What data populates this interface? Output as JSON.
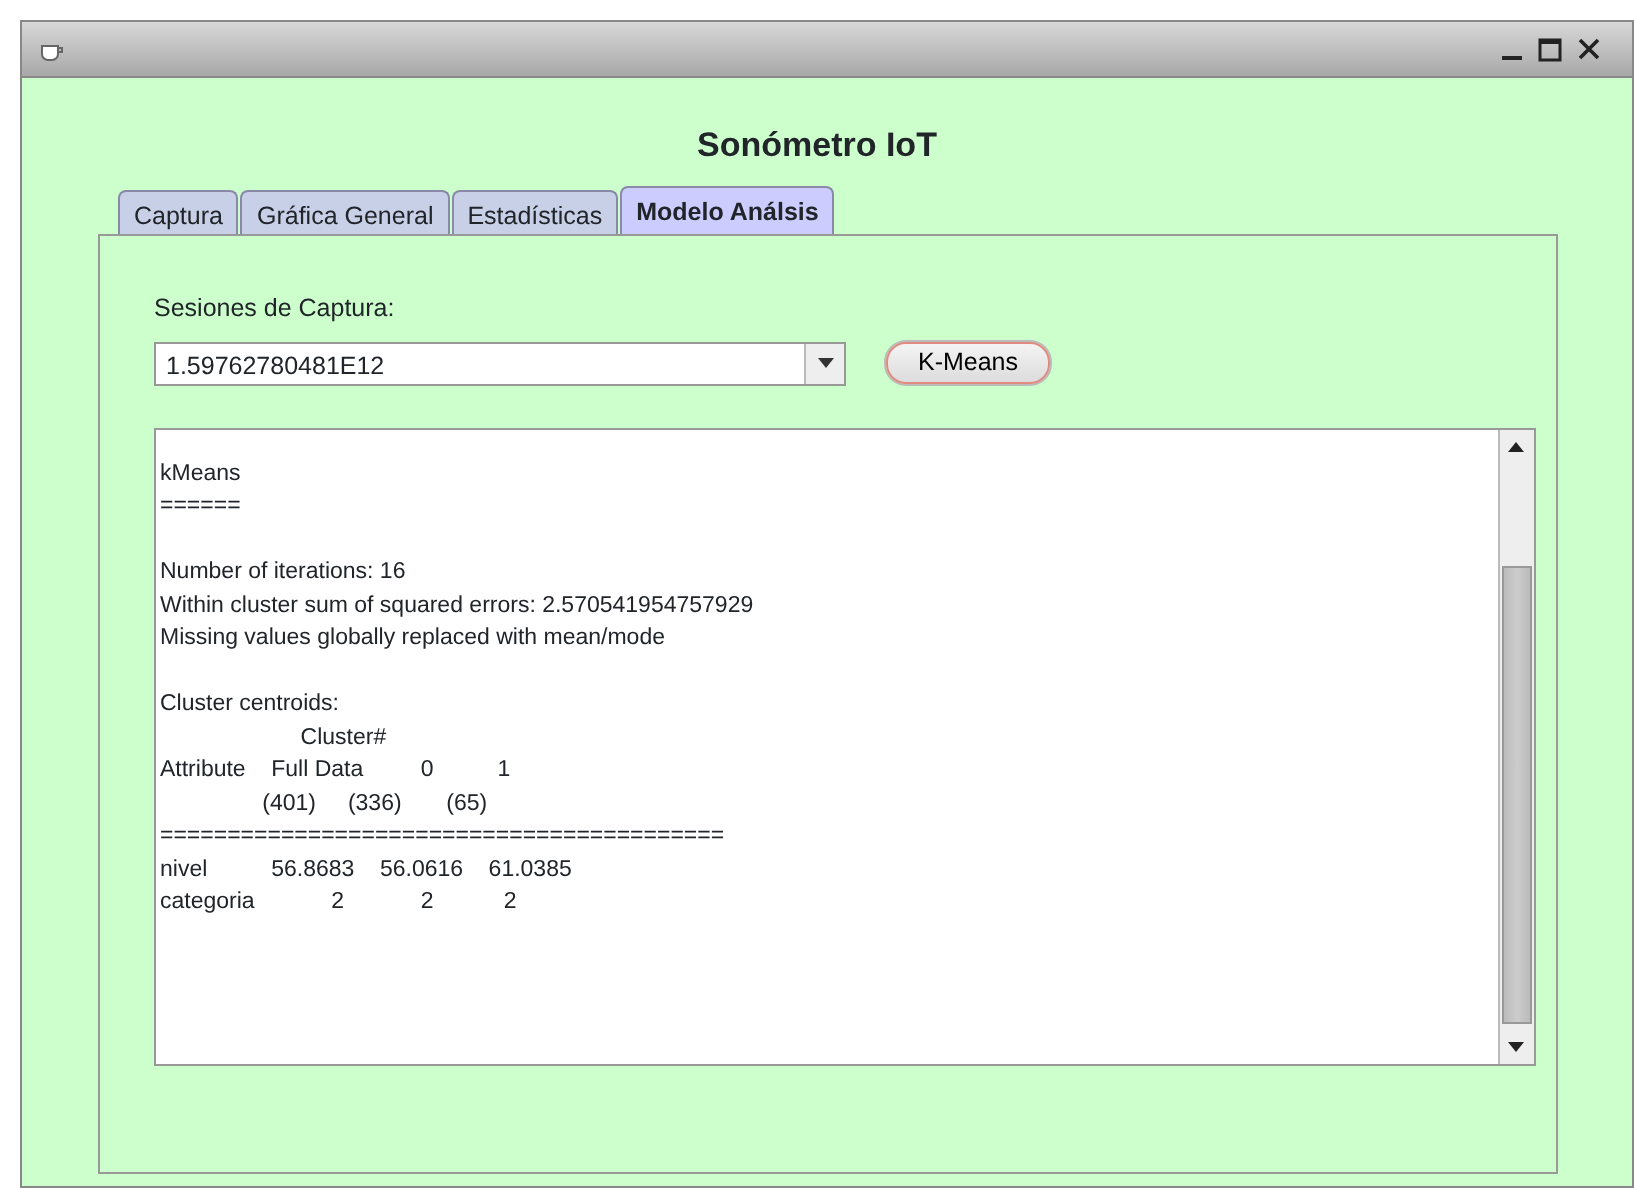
{
  "window": {
    "title": "Sonómetro IoT"
  },
  "tabs": [
    {
      "label": "Captura",
      "selected": false
    },
    {
      "label": "Gráfica General",
      "selected": false
    },
    {
      "label": "Estadísticas",
      "selected": false
    },
    {
      "label": "Modelo Análsis",
      "selected": true
    }
  ],
  "sessions": {
    "label": "Sesiones de Captura:",
    "value": "1.59762780481E12"
  },
  "run_button": {
    "label": "K-Means"
  },
  "output": {
    "blocks": [
      [
        "kMeans",
        "======"
      ],
      [
        "Number of iterations: 16",
        "Within cluster sum of squared errors: 2.570541954757929",
        "Missing values globally replaced with mean/mode"
      ],
      [
        "Cluster centroids:",
        "                      Cluster#",
        "Attribute    Full Data         0          1",
        "                (401)     (336)       (65)",
        "==========================================",
        "nivel          56.8683    56.0616    61.0385",
        "categoria            2            2           2"
      ]
    ]
  }
}
